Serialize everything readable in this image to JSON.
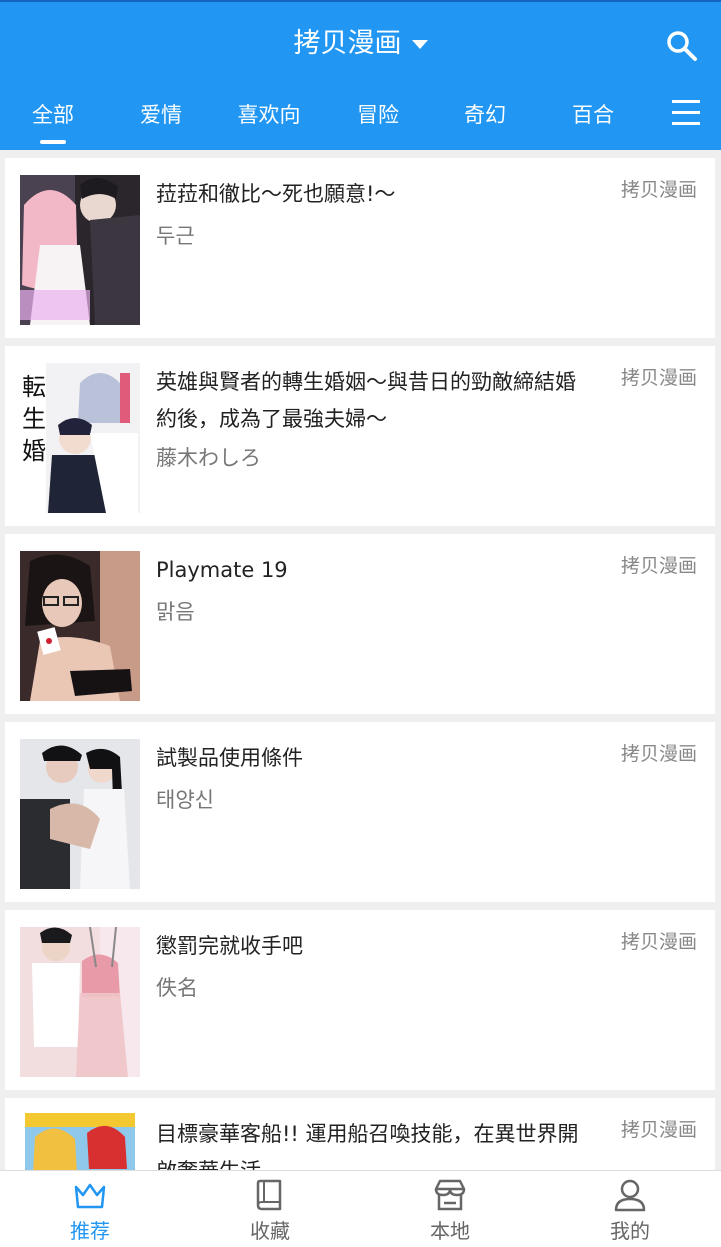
{
  "header": {
    "title": "拷贝漫画",
    "tabs": [
      "全部",
      "爱情",
      "喜欢向",
      "冒险",
      "奇幻",
      "百合"
    ]
  },
  "comics": [
    {
      "title": "菈菈和徹比〜死也願意!〜",
      "author": "두근",
      "source": "拷贝漫画"
    },
    {
      "title": "英雄與賢者的轉生婚姻〜與昔日的勁敵締結婚約後，成為了最強夫婦〜",
      "author": "藤木わしろ",
      "source": "拷贝漫画"
    },
    {
      "title": "Playmate 19",
      "author": "맑음",
      "source": "拷贝漫画"
    },
    {
      "title": "試製品使用條件",
      "author": "태양신",
      "source": "拷贝漫画"
    },
    {
      "title": "懲罰完就收手吧",
      "author": "佚名",
      "source": "拷贝漫画"
    },
    {
      "title": "目標豪華客船!! 運用船召喚技能，在異世界開啟奢華生活",
      "author": "",
      "source": "拷贝漫画"
    }
  ],
  "bottom_nav": [
    {
      "label": "推荐",
      "icon": "crown-icon"
    },
    {
      "label": "收藏",
      "icon": "book-icon"
    },
    {
      "label": "本地",
      "icon": "store-icon"
    },
    {
      "label": "我的",
      "icon": "person-icon"
    }
  ],
  "colors": {
    "accent": "#2196f3",
    "background": "#efefef"
  }
}
